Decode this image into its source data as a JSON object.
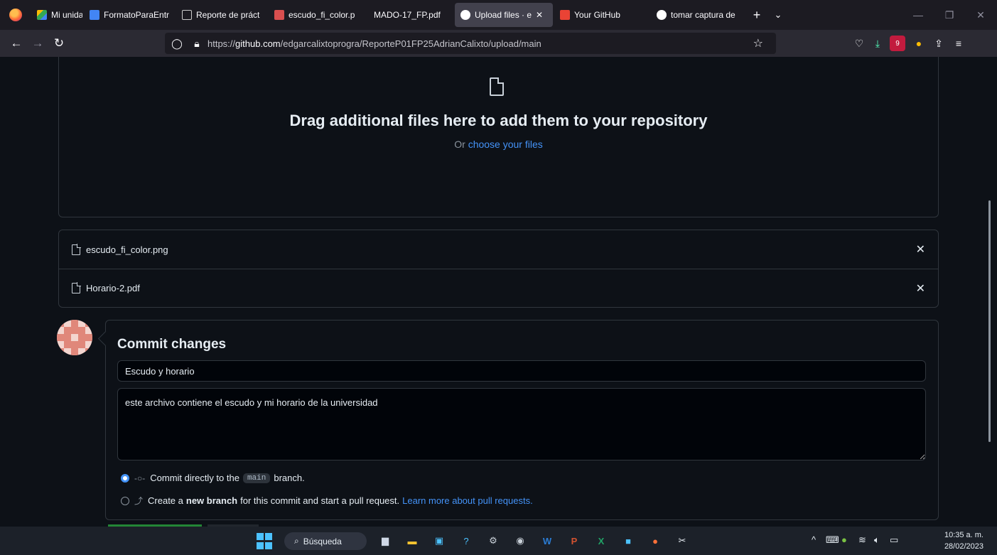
{
  "browser": {
    "tabs": [
      {
        "label": "Mi unidad - Goo",
        "favicon": "google-drive-icon",
        "color": "#34a853"
      },
      {
        "label": "FormatoParaEntr",
        "favicon": "google-docs-icon",
        "color": "#4285f4"
      },
      {
        "label": "Reporte de práct",
        "favicon": "slides-icon",
        "color": "#aaaaaa"
      },
      {
        "label": "escudo_fi_color.p",
        "favicon": "image-icon",
        "color": "#d94f4f"
      },
      {
        "label": "MADO-17_FP.pdf",
        "favicon": "pdf-icon",
        "color": "#1c1b22"
      },
      {
        "label": "Upload files · e",
        "favicon": "github-icon",
        "color": "#ffffff"
      },
      {
        "label": "Your GitHub",
        "favicon": "gmail-icon",
        "color": "#ea4335"
      },
      {
        "label": "tomar captura de",
        "favicon": "google-icon",
        "color": "#4285f4"
      }
    ],
    "url_prefix": "https://",
    "url_host": "github.com",
    "url_path": "/edgarcalixtoprogra/ReporteP01FP25AdrianCalixto/upload/main",
    "ext_badge": "9"
  },
  "dropzone": {
    "title": "Drag additional files here to add them to your repository",
    "or_text": "Or ",
    "choose_link": "choose your files"
  },
  "files": [
    {
      "name": "escudo_fi_color.png"
    },
    {
      "name": "Horario-2.pdf"
    }
  ],
  "commit": {
    "title": "Commit changes",
    "summary_value": "Escudo y horario",
    "description_value": "este archivo contiene el escudo y mi horario de la universidad",
    "option_direct": {
      "prefix": "Commit directly to the",
      "branch": "main",
      "suffix": "branch."
    },
    "option_new": {
      "prefix": "Create a",
      "bold": "new branch",
      "suffix": "for this commit and start a pull request.",
      "link": "Learn more about pull requests."
    }
  },
  "taskbar": {
    "search_label": "Búsqueda",
    "time": "10:35 a. m.",
    "date": "28/02/2023"
  },
  "colors": {
    "accent": "#4493f8",
    "background": "#0d1117",
    "border": "#30363d"
  }
}
